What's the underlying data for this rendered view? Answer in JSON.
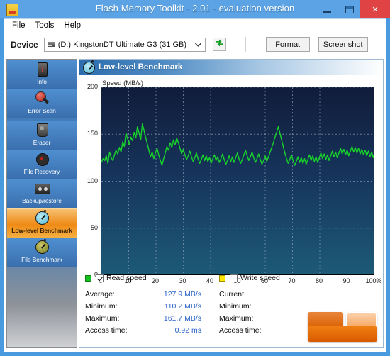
{
  "window": {
    "title": "Flash Memory Toolkit - 2.01 - evaluation version",
    "app_icon": "usb-drive-icon",
    "minimize_label": "–",
    "maximize_label": "□",
    "close_label": "×",
    "accent_color": "#5ba3e5",
    "close_color": "#e04343"
  },
  "menu": {
    "items": [
      {
        "label": "File"
      },
      {
        "label": "Tools"
      },
      {
        "label": "Help"
      }
    ]
  },
  "toolbar": {
    "device_label": "Device",
    "device_value": "(D:) KingstonDT Ultimate G3 (31 GB)",
    "device_options": [
      "(D:) KingstonDT Ultimate G3 (31 GB)"
    ],
    "chevron": "⌄",
    "refresh_icon": "refresh-icon",
    "format_label": "Format",
    "screenshot_label": "Screenshot"
  },
  "sidebar": {
    "items": [
      {
        "label": "Info",
        "icon": "info-icon",
        "active": false
      },
      {
        "label": "Error Scan",
        "icon": "magnifier-icon",
        "active": false
      },
      {
        "label": "Eraser",
        "icon": "eraser-icon",
        "active": false
      },
      {
        "label": "File Recovery",
        "icon": "disc-icon",
        "active": false
      },
      {
        "label": "Backup/restore",
        "icon": "tape-icon",
        "active": false
      },
      {
        "label": "Low-level Benchmark",
        "icon": "stopwatch-icon",
        "active": true
      },
      {
        "label": "File Benchmark",
        "icon": "stopwatch-olive-icon",
        "active": false
      }
    ],
    "active_color": "#ef8a16"
  },
  "panel": {
    "title": "Low-level Benchmark",
    "icon": "stopwatch-icon"
  },
  "chart_data": {
    "type": "line",
    "title": "",
    "ylabel": "Speed (MB/s)",
    "xlabel": "",
    "ylim": [
      0,
      200
    ],
    "xlim": [
      0,
      100
    ],
    "yticks": [
      0,
      50,
      100,
      150,
      200
    ],
    "xticks": [
      "0",
      "10",
      "20",
      "30",
      "40",
      "50",
      "60",
      "70",
      "80",
      "90",
      "100%"
    ],
    "grid": true,
    "legend_position": "below",
    "plot_bg_top": "#111c3a",
    "plot_bg_bottom": "#1d5a78",
    "series": [
      {
        "name": "Read speed",
        "color": "#18d42a",
        "visible": true,
        "x": [
          0,
          0.6,
          1.2,
          1.8,
          2.4,
          3,
          3.6,
          4.2,
          4.8,
          5.4,
          6,
          6.6,
          7.2,
          7.8,
          8.4,
          9,
          9.6,
          10.2,
          10.8,
          11.4,
          12,
          12.6,
          13.2,
          13.8,
          14.4,
          15,
          15.6,
          16.2,
          16.8,
          17.4,
          18,
          18.6,
          19.2,
          19.8,
          20.4,
          21,
          21.6,
          22.2,
          22.8,
          23.4,
          24,
          24.6,
          25.2,
          25.8,
          26.4,
          27,
          27.6,
          28.2,
          28.8,
          29.4,
          30,
          30.6,
          31.2,
          31.8,
          32.4,
          33,
          33.6,
          34.2,
          34.8,
          35.4,
          36,
          36.6,
          37.2,
          37.8,
          38.4,
          39,
          39.6,
          40.2,
          40.8,
          41.4,
          42,
          42.6,
          43.2,
          43.8,
          44.4,
          45,
          45.6,
          46.2,
          46.8,
          47.4,
          48,
          48.6,
          49.2,
          49.8,
          50.4,
          51,
          51.6,
          52.2,
          52.8,
          53.4,
          54,
          54.6,
          55.2,
          55.8,
          56.4,
          57,
          57.6,
          58.2,
          58.8,
          59.4,
          60,
          60.6,
          61.2,
          61.8,
          62.4,
          63,
          63.6,
          64.2,
          64.8,
          65.4,
          66,
          66.6,
          67.2,
          67.8,
          68.4,
          69,
          69.6,
          70.2,
          70.8,
          71.4,
          72,
          72.6,
          73.2,
          73.8,
          74.4,
          75,
          75.6,
          76.2,
          76.8,
          77.4,
          78,
          78.6,
          79.2,
          79.8,
          80.4,
          81,
          81.6,
          82.2,
          82.8,
          83.4,
          84,
          84.6,
          85.2,
          85.8,
          86.4,
          87,
          87.6,
          88.2,
          88.8,
          89.4,
          90,
          90.6,
          91.2,
          91.8,
          92.4,
          93,
          93.6,
          94.2,
          94.8,
          95.4,
          96,
          96.6,
          97.2,
          97.8,
          98.4,
          99,
          99.6,
          100
        ],
        "y": [
          120,
          124,
          122,
          127,
          119,
          131,
          125,
          122,
          128,
          133,
          129,
          136,
          131,
          142,
          137,
          151,
          145,
          139,
          147,
          143,
          152,
          146,
          158,
          151,
          144,
          161,
          154,
          147,
          140,
          133,
          126,
          131,
          124,
          130,
          135,
          128,
          122,
          117,
          124,
          130,
          137,
          133,
          141,
          136,
          144,
          139,
          146,
          141,
          135,
          129,
          134,
          128,
          123,
          127,
          132,
          126,
          121,
          125,
          130,
          124,
          119,
          123,
          128,
          122,
          127,
          121,
          125,
          119,
          124,
          128,
          122,
          126,
          120,
          124,
          129,
          123,
          118,
          122,
          127,
          121,
          126,
          120,
          125,
          130,
          124,
          119,
          123,
          128,
          133,
          127,
          122,
          126,
          131,
          125,
          120,
          124,
          129,
          123,
          118,
          122,
          127,
          121,
          126,
          131,
          136,
          141,
          147,
          152,
          158,
          151,
          144,
          137,
          130,
          124,
          119,
          123,
          128,
          122,
          117,
          121,
          126,
          120,
          125,
          119,
          124,
          118,
          123,
          128,
          122,
          127,
          121,
          126,
          120,
          125,
          130,
          124,
          129,
          123,
          128,
          122,
          127,
          132,
          126,
          131,
          125,
          130,
          135,
          129,
          134,
          128,
          133,
          127,
          132,
          137,
          131,
          136,
          130,
          135,
          129,
          134,
          128,
          133,
          127,
          132,
          126,
          131,
          125,
          130,
          124,
          129,
          123,
          128,
          122,
          126,
          120,
          124,
          118
        ]
      },
      {
        "name": "Write speed",
        "color": "#ffe500",
        "visible": false,
        "x": [],
        "y": []
      }
    ]
  },
  "legend": {
    "read": {
      "label": "Read speed",
      "checked": true,
      "swatch": "#16c020"
    },
    "write": {
      "label": "Write speed",
      "checked": false,
      "swatch": "#ffe500"
    }
  },
  "stats": {
    "read": {
      "rows": [
        {
          "label": "Average:",
          "value": "127.9 MB/s"
        },
        {
          "label": "Minimum:",
          "value": "110.2 MB/s"
        },
        {
          "label": "Maximum:",
          "value": "161.7 MB/s"
        },
        {
          "label": "Access time:",
          "value": "0.92 ms"
        }
      ]
    },
    "write": {
      "rows": [
        {
          "label": "Current:",
          "value": ""
        },
        {
          "label": "Minimum:",
          "value": ""
        },
        {
          "label": "Maximum:",
          "value": ""
        },
        {
          "label": "Access time:",
          "value": ""
        }
      ]
    }
  }
}
